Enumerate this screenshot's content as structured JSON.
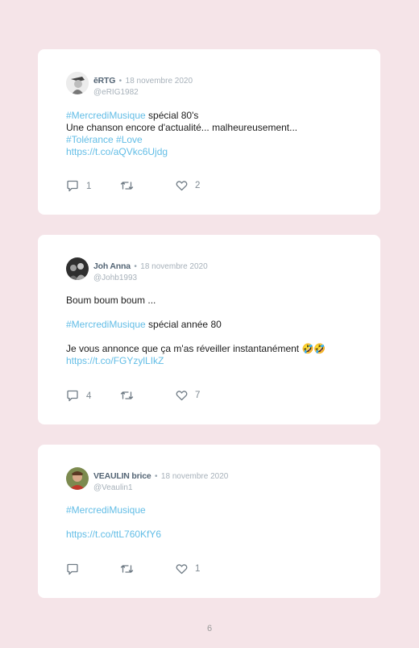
{
  "tweets": [
    {
      "name": "ēRTG",
      "separator": "•",
      "date": "18 novembre 2020",
      "handle": "@eRIG1982",
      "lines": [
        [
          {
            "t": "#MercrediMusique",
            "link": true
          },
          {
            "t": " spécial 80's",
            "link": false
          }
        ],
        [
          {
            "t": "Une chanson encore d'actualité... malheureusement...",
            "link": false
          }
        ],
        [
          {
            "t": "#Tolérance #Love",
            "link": true
          }
        ],
        [
          {
            "t": "https://t.co/aQVkc6Ujdg",
            "link": true
          }
        ]
      ],
      "replies": "1",
      "retweets": "",
      "likes": "2"
    },
    {
      "name": "Joh Anna",
      "separator": "•",
      "date": "18 novembre 2020",
      "handle": "@Johb1993",
      "lines": [
        [
          {
            "t": "Boum boum boum ...",
            "link": false
          }
        ],
        [],
        [
          {
            "t": "#MercrediMusique",
            "link": true
          },
          {
            "t": " spécial année 80",
            "link": false
          }
        ],
        [],
        [
          {
            "t": "Je vous annonce que ça m'as réveiller instantanément 🤣🤣",
            "link": false
          }
        ],
        [
          {
            "t": "https://t.co/FGYzylLIkZ",
            "link": true
          }
        ]
      ],
      "replies": "4",
      "retweets": "",
      "likes": "7"
    },
    {
      "name": "VEAULIN brice",
      "separator": "•",
      "date": "18 novembre 2020",
      "handle": "@Veaulin1",
      "lines": [
        [
          {
            "t": "#MercrediMusique",
            "link": true
          }
        ],
        [],
        [
          {
            "t": "https://t.co/ttL760KfY6",
            "link": true
          }
        ]
      ],
      "replies": "",
      "retweets": "",
      "likes": "1"
    }
  ],
  "page_number": "6",
  "colors": {
    "background": "#f5e4e8",
    "card": "#ffffff",
    "link": "#62bde6",
    "icon": "#6f7b85"
  }
}
